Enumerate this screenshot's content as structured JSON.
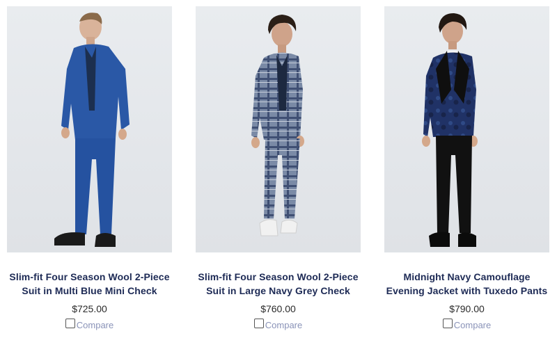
{
  "products": [
    {
      "name": "Slim-fit Four Season Wool 2-Piece Suit in Multi Blue Mini Check",
      "price": "$725.00",
      "compare_label": "Compare",
      "image_alt": "Model in slim-fit multi blue mini check suit",
      "suit_color": "#2a58a6"
    },
    {
      "name": "Slim-fit Four Season Wool 2-Piece Suit in Large Navy Grey Check",
      "price": "$760.00",
      "compare_label": "Compare",
      "image_alt": "Model in navy grey large check suit",
      "suit_color": "#6c7f9c"
    },
    {
      "name": "Midnight Navy Camouflage Evening Jacket with Tuxedo Pants",
      "price": "$790.00",
      "compare_label": "Compare",
      "image_alt": "Model in midnight navy camouflage evening jacket",
      "suit_color": "#1f2f5c"
    }
  ]
}
